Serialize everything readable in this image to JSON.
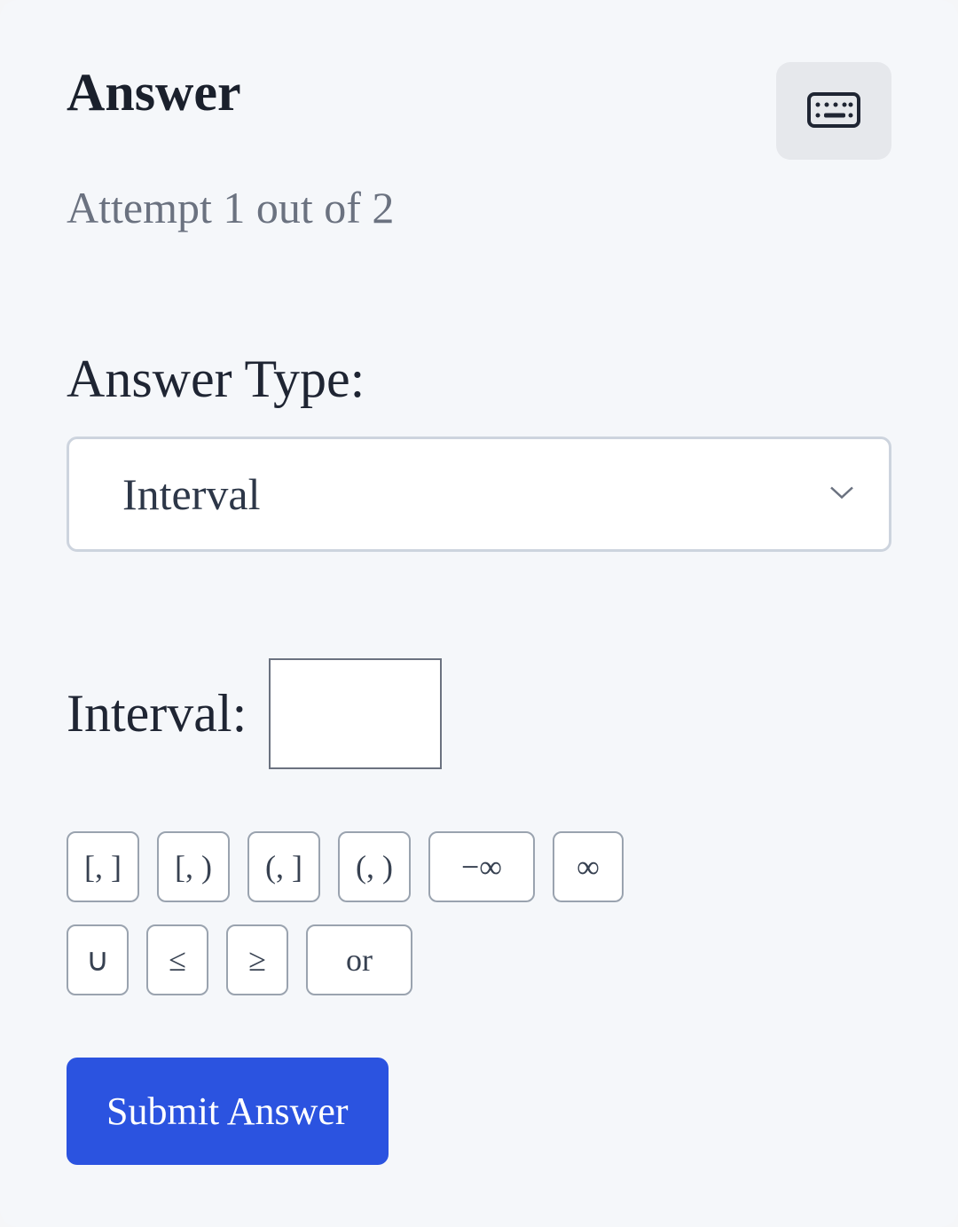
{
  "header": {
    "title": "Answer",
    "subtitle": "Attempt 1 out of 2"
  },
  "answerType": {
    "label": "Answer Type:",
    "selected": "Interval"
  },
  "interval": {
    "label": "Interval:",
    "value": ""
  },
  "symbols": {
    "row1": [
      {
        "label": "[, ]",
        "name": "closed-closed"
      },
      {
        "label": "[, )",
        "name": "closed-open"
      },
      {
        "label": "(, ]",
        "name": "open-closed"
      },
      {
        "label": "(, )",
        "name": "open-open"
      },
      {
        "label": "−∞",
        "name": "negative-infinity"
      },
      {
        "label": "∞",
        "name": "infinity"
      }
    ],
    "row2": [
      {
        "label": "∪",
        "name": "union"
      },
      {
        "label": "≤",
        "name": "less-equal"
      },
      {
        "label": "≥",
        "name": "greater-equal"
      },
      {
        "label": "or",
        "name": "or"
      }
    ]
  },
  "submit": {
    "label": "Submit Answer"
  }
}
